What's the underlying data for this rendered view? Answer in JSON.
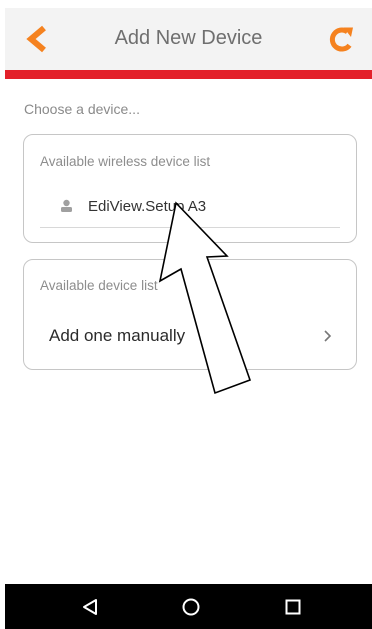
{
  "header": {
    "title": "Add New Device",
    "back_icon": "chevron-left-icon",
    "refresh_icon": "refresh-icon",
    "accent_color": "#f5821f",
    "divider_color": "#e3202a"
  },
  "main": {
    "subtitle": "Choose a device...",
    "wireless_card": {
      "header": "Available wireless device list",
      "devices": [
        {
          "name": "EdiView.Setup A3",
          "icon": "device-icon"
        }
      ]
    },
    "device_card": {
      "header": "Available device list",
      "manual_label": "Add one manually",
      "chevron_icon": "chevron-right-icon"
    }
  },
  "navbar": {
    "back_icon": "triangle-back-icon",
    "home_icon": "circle-home-icon",
    "recent_icon": "square-recent-icon"
  }
}
